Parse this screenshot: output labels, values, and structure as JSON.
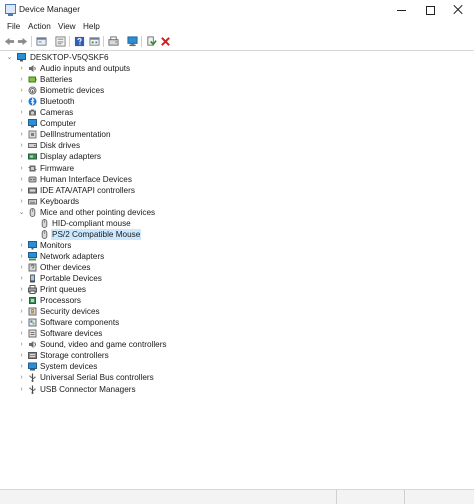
{
  "window": {
    "title": "Device Manager"
  },
  "menu": [
    "File",
    "Action",
    "View",
    "Help"
  ],
  "toolbar": [
    "back-arrow-icon",
    "forward-arrow-icon",
    "properties-icon",
    "show-hide-console-tree-icon",
    "help-icon",
    "view-grid-icon",
    "update-driver-icon",
    "scan-hardware-icon",
    "enable-device-icon",
    "uninstall-device-icon"
  ],
  "tree": {
    "root": "DESKTOP-V5QSKF6",
    "items": [
      {
        "label": "Audio inputs and outputs",
        "icon": "speaker-icon",
        "expanded": false
      },
      {
        "label": "Batteries",
        "icon": "battery-icon",
        "expanded": false
      },
      {
        "label": "Biometric devices",
        "icon": "fingerprint-icon",
        "expanded": false
      },
      {
        "label": "Bluetooth",
        "icon": "bluetooth-icon",
        "expanded": false
      },
      {
        "label": "Cameras",
        "icon": "camera-icon",
        "expanded": false
      },
      {
        "label": "Computer",
        "icon": "computer-icon",
        "expanded": false
      },
      {
        "label": "DellInstrumentation",
        "icon": "device-icon",
        "expanded": false
      },
      {
        "label": "Disk drives",
        "icon": "disk-drive-icon",
        "expanded": false
      },
      {
        "label": "Display adapters",
        "icon": "display-adapter-icon",
        "expanded": false
      },
      {
        "label": "Firmware",
        "icon": "firmware-icon",
        "expanded": false
      },
      {
        "label": "Human Interface Devices",
        "icon": "hid-icon",
        "expanded": false
      },
      {
        "label": "IDE ATA/ATAPI controllers",
        "icon": "ide-controller-icon",
        "expanded": false
      },
      {
        "label": "Keyboards",
        "icon": "keyboard-icon",
        "expanded": false
      },
      {
        "label": "Mice and other pointing devices",
        "icon": "mouse-icon",
        "expanded": true,
        "children": [
          {
            "label": "HID-compliant mouse",
            "icon": "mouse-icon",
            "selected": false
          },
          {
            "label": "PS/2 Compatible Mouse",
            "icon": "mouse-icon",
            "selected": true
          }
        ]
      },
      {
        "label": "Monitors",
        "icon": "monitor-icon",
        "expanded": false
      },
      {
        "label": "Network adapters",
        "icon": "network-adapter-icon",
        "expanded": false
      },
      {
        "label": "Other devices",
        "icon": "other-device-icon",
        "expanded": false
      },
      {
        "label": "Portable Devices",
        "icon": "portable-device-icon",
        "expanded": false
      },
      {
        "label": "Print queues",
        "icon": "printer-icon",
        "expanded": false
      },
      {
        "label": "Processors",
        "icon": "processor-icon",
        "expanded": false
      },
      {
        "label": "Security devices",
        "icon": "security-device-icon",
        "expanded": false
      },
      {
        "label": "Software components",
        "icon": "software-component-icon",
        "expanded": false
      },
      {
        "label": "Software devices",
        "icon": "software-device-icon",
        "expanded": false
      },
      {
        "label": "Sound, video and game controllers",
        "icon": "sound-icon",
        "expanded": false
      },
      {
        "label": "Storage controllers",
        "icon": "storage-controller-icon",
        "expanded": false
      },
      {
        "label": "System devices",
        "icon": "system-device-icon",
        "expanded": false
      },
      {
        "label": "Universal Serial Bus controllers",
        "icon": "usb-icon",
        "expanded": false
      },
      {
        "label": "USB Connector Managers",
        "icon": "usb-icon",
        "expanded": false
      }
    ]
  },
  "colors": {
    "selection": "#cce8ff",
    "accent": "#1e78d2"
  }
}
